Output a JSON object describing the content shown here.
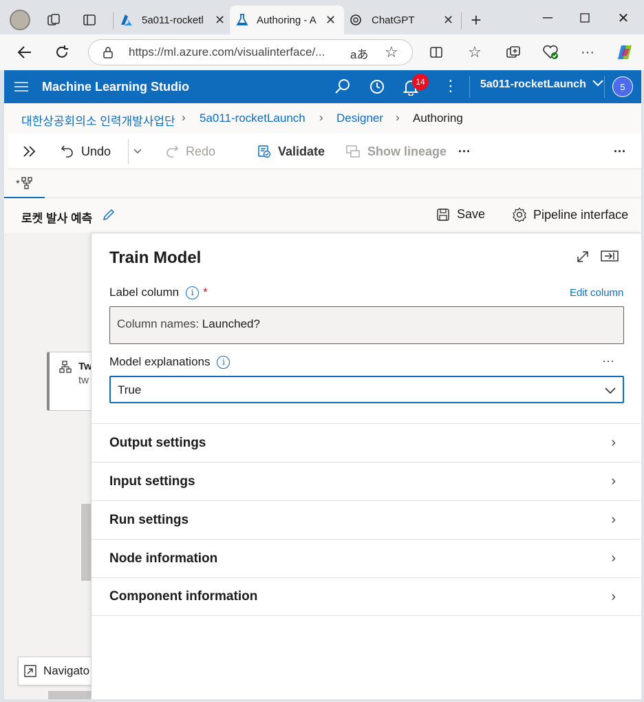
{
  "browser": {
    "tabs": [
      {
        "label": "5a011-rocketl",
        "icon": "azure-icon"
      },
      {
        "label": "Authoring - A",
        "icon": "flask-icon"
      },
      {
        "label": "ChatGPT",
        "icon": "openai-icon"
      }
    ],
    "url": "https://ml.azure.com/visualinterface/...",
    "read_aloud": "aあ"
  },
  "appbar": {
    "title": "Machine Learning Studio",
    "notification_count": "14",
    "workspace": "5a011-rocketLaunch",
    "avatar": "5"
  },
  "breadcrumb": [
    "대한상공회의소 인력개발사업단",
    "5a011-rocketLaunch",
    "Designer",
    "Authoring"
  ],
  "toolbar": {
    "undo": "Undo",
    "redo": "Redo",
    "validate": "Validate",
    "show_lineage": "Show lineage",
    "more": "···"
  },
  "tab_label": "*",
  "pipeline": {
    "name": "로켓 발사 예측",
    "save": "Save",
    "pipeline_interface": "Pipeline interface"
  },
  "canvas": {
    "node_line1": "Tw",
    "node_line2": "tw",
    "navigator": "Navigato"
  },
  "panel": {
    "title": "Train Model",
    "label_column": "Label column",
    "required_mark": "*",
    "edit_column": "Edit column",
    "column_names_prefix": "Column names:",
    "column_names_value": "Launched?",
    "model_explanations": "Model explanations",
    "model_explanations_value": "True",
    "more": "···",
    "sections": [
      "Output settings",
      "Input settings",
      "Run settings",
      "Node information",
      "Component information"
    ]
  },
  "colors": {
    "accent": "#0f6cbd",
    "badge": "#e81123"
  }
}
